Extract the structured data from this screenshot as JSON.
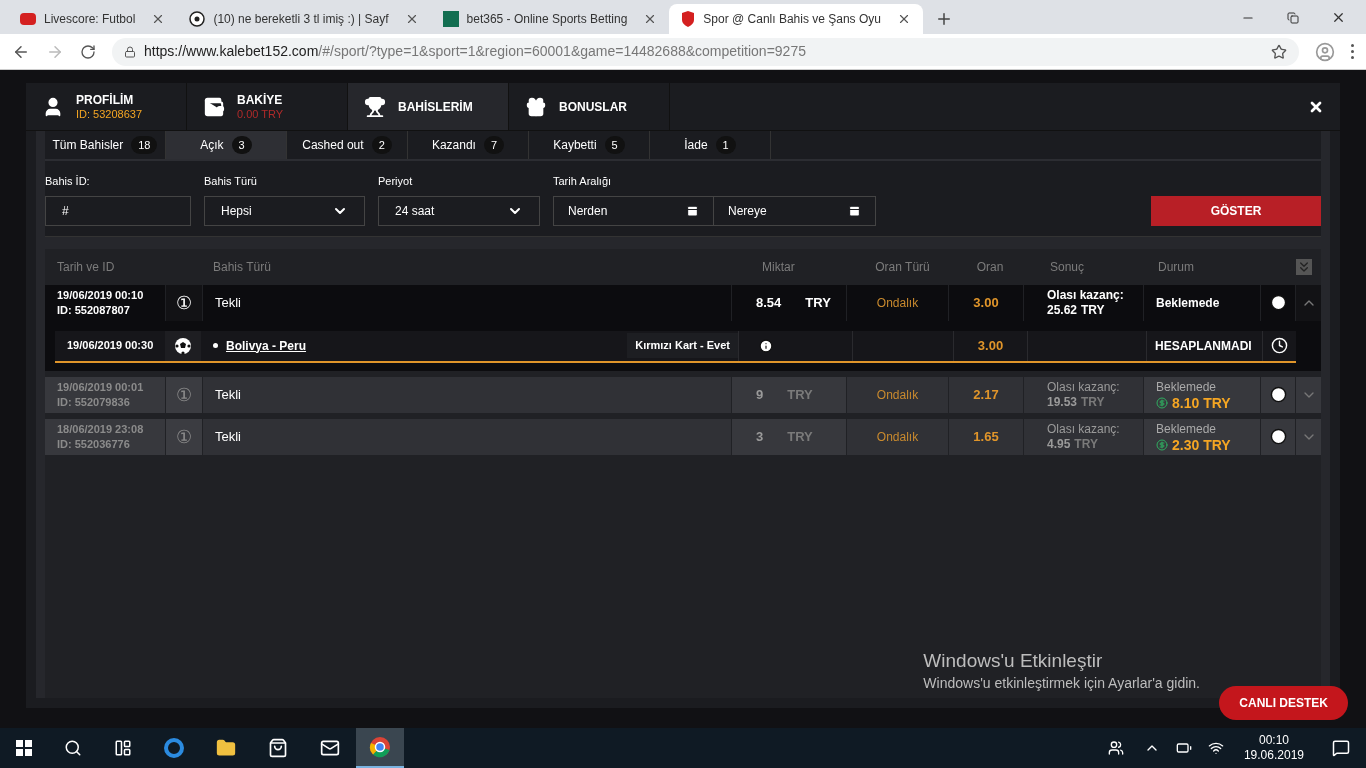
{
  "browser": {
    "tabs": [
      {
        "title": "Livescore: Futbol",
        "selected": false
      },
      {
        "title": "(10) ne bereketli 3 tl imiş :) | Sayf",
        "selected": false
      },
      {
        "title": "bet365 - Online Sports Betting",
        "selected": false
      },
      {
        "title": "Spor @ Canlı Bahis ve Şans Oyu",
        "selected": true
      }
    ],
    "url_host": "https://www.kalebet152.com",
    "url_path": "/#/sport/?type=1&sport=1&region=60001&game=14482688&competition=9275"
  },
  "modal": {
    "header_tabs": [
      {
        "kind": "profile",
        "label": "PROFİLİM",
        "sub": "ID: 53208637",
        "selected": false
      },
      {
        "kind": "balance",
        "label": "BAKİYE",
        "sub": "0.00 TRY",
        "selected": false
      },
      {
        "kind": "bets",
        "label": "BAHİSLERİM",
        "selected": true
      },
      {
        "kind": "bonus",
        "label": "BONUSLAR",
        "selected": false
      }
    ],
    "filter_tabs": [
      {
        "label": "Tüm Bahisler",
        "count": "18",
        "selected": false
      },
      {
        "label": "Açık",
        "count": "3",
        "selected": true
      },
      {
        "label": "Cashed out",
        "count": "2",
        "selected": false
      },
      {
        "label": "Kazandı",
        "count": "7",
        "selected": false
      },
      {
        "label": "Kaybetti",
        "count": "5",
        "selected": false
      },
      {
        "label": "İade",
        "count": "1",
        "selected": false
      }
    ],
    "filters": {
      "bet_id": {
        "label": "Bahis İD:",
        "value": "#"
      },
      "bet_type": {
        "label": "Bahis Türü",
        "value": "Hepsi"
      },
      "period": {
        "label": "Periyot",
        "value": "24 saat"
      },
      "date_range": {
        "label": "Tarih Aralığı",
        "from": "Nerden",
        "to": "Nereye"
      },
      "show_button": "GÖSTER"
    },
    "table": {
      "columns": [
        "Tarih ve ID",
        "Bahis Türü",
        "Miktar",
        "Oran Türü",
        "Oran",
        "Sonuç",
        "Durum"
      ],
      "rows": [
        {
          "date": "19/06/2019 00:10",
          "id": "ID: 552087807",
          "mark": "①",
          "type": "Tekli",
          "amount": "8.54",
          "currency": "TRY",
          "odds_type": "Ondalık",
          "odds": "3.00",
          "result_label": "Olası kazanç:",
          "result_amount": "25.62",
          "result_currency": "TRY",
          "status": "Beklemede",
          "expanded": true,
          "events": [
            {
              "date": "19/06/2019 00:30",
              "match": "Bolivya - Peru",
              "market": "Kırmızı Kart - Evet",
              "odds": "3.00",
              "status": "HESAPLANMADI"
            }
          ]
        },
        {
          "date": "19/06/2019 00:01",
          "id": "ID: 552079836",
          "mark": "①",
          "type": "Tekli",
          "amount": "9",
          "currency": "TRY",
          "odds_type": "Ondalık",
          "odds": "2.17",
          "result_label": "Olası kazanç:",
          "result_amount": "19.53",
          "result_currency": "TRY",
          "status": "Beklemede",
          "cashout": "8.10 TRY",
          "expanded": false
        },
        {
          "date": "18/06/2019 23:08",
          "id": "ID: 552036776",
          "mark": "①",
          "type": "Tekli",
          "amount": "3",
          "currency": "TRY",
          "odds_type": "Ondalık",
          "odds": "1.65",
          "result_label": "Olası kazanç:",
          "result_amount": "4.95",
          "result_currency": "TRY",
          "status": "Beklemede",
          "cashout": "2.30 TRY",
          "expanded": false
        }
      ]
    }
  },
  "activation": {
    "title": "Windows'u Etkinleştir",
    "text": "Windows'u etkinleştirmek için Ayarlar'a gidin."
  },
  "support_button": "CANLI DESTEK",
  "taskbar": {
    "time": "00:10",
    "date": "19.06.2019"
  }
}
